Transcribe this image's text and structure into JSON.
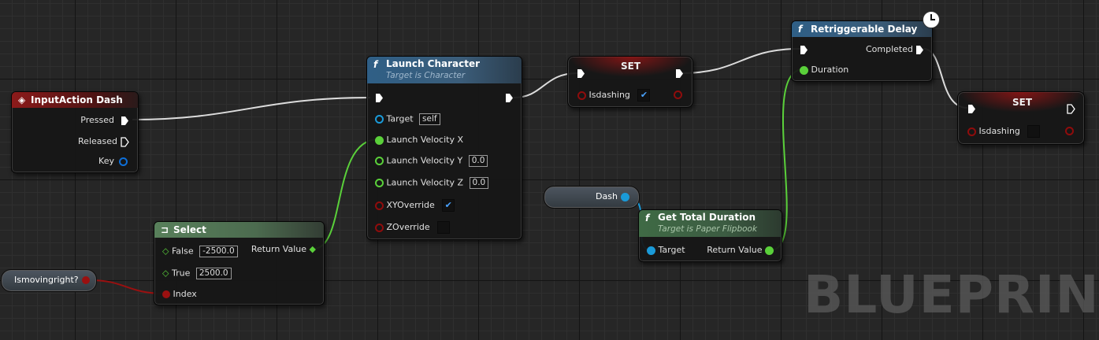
{
  "watermark": "BLUEPRINT",
  "colors": {
    "exec": "#ffffff",
    "float": "#5ad03a",
    "bool": "#8f0c0c",
    "object": "#1a9ad8",
    "struct": "#0e6fd8"
  },
  "input_action": {
    "title": "InputAction Dash",
    "icon": "input-action-icon",
    "pins": {
      "pressed": "Pressed",
      "released": "Released",
      "key": "Key"
    }
  },
  "launch": {
    "title": "Launch Character",
    "subtitle": "Target is Character",
    "pins": {
      "target": "Target",
      "target_value": "self",
      "vx": "Launch Velocity X",
      "vy": "Launch Velocity Y",
      "vy_value": "0.0",
      "vz": "Launch Velocity Z",
      "vz_value": "0.0",
      "xy": "XYOverride",
      "z": "ZOverride"
    },
    "xy_checked": true,
    "z_checked": false
  },
  "select": {
    "title": "Select",
    "pins": {
      "false": "False",
      "false_value": "-2500.0",
      "true": "True",
      "true_value": "2500.0",
      "index": "Index",
      "ret": "Return Value"
    }
  },
  "ismovingright": {
    "label": "Ismovingright?"
  },
  "set1": {
    "title": "SET",
    "var": "Isdashing",
    "checked": true
  },
  "set2": {
    "title": "SET",
    "var": "Isdashing",
    "checked": false
  },
  "retrig": {
    "title": "Retriggerable Delay",
    "pins": {
      "duration": "Duration",
      "completed": "Completed"
    }
  },
  "dash": {
    "label": "Dash"
  },
  "gettotal": {
    "title": "Get Total Duration",
    "subtitle": "Target is Paper Flipbook",
    "pins": {
      "target": "Target",
      "ret": "Return Value"
    }
  }
}
